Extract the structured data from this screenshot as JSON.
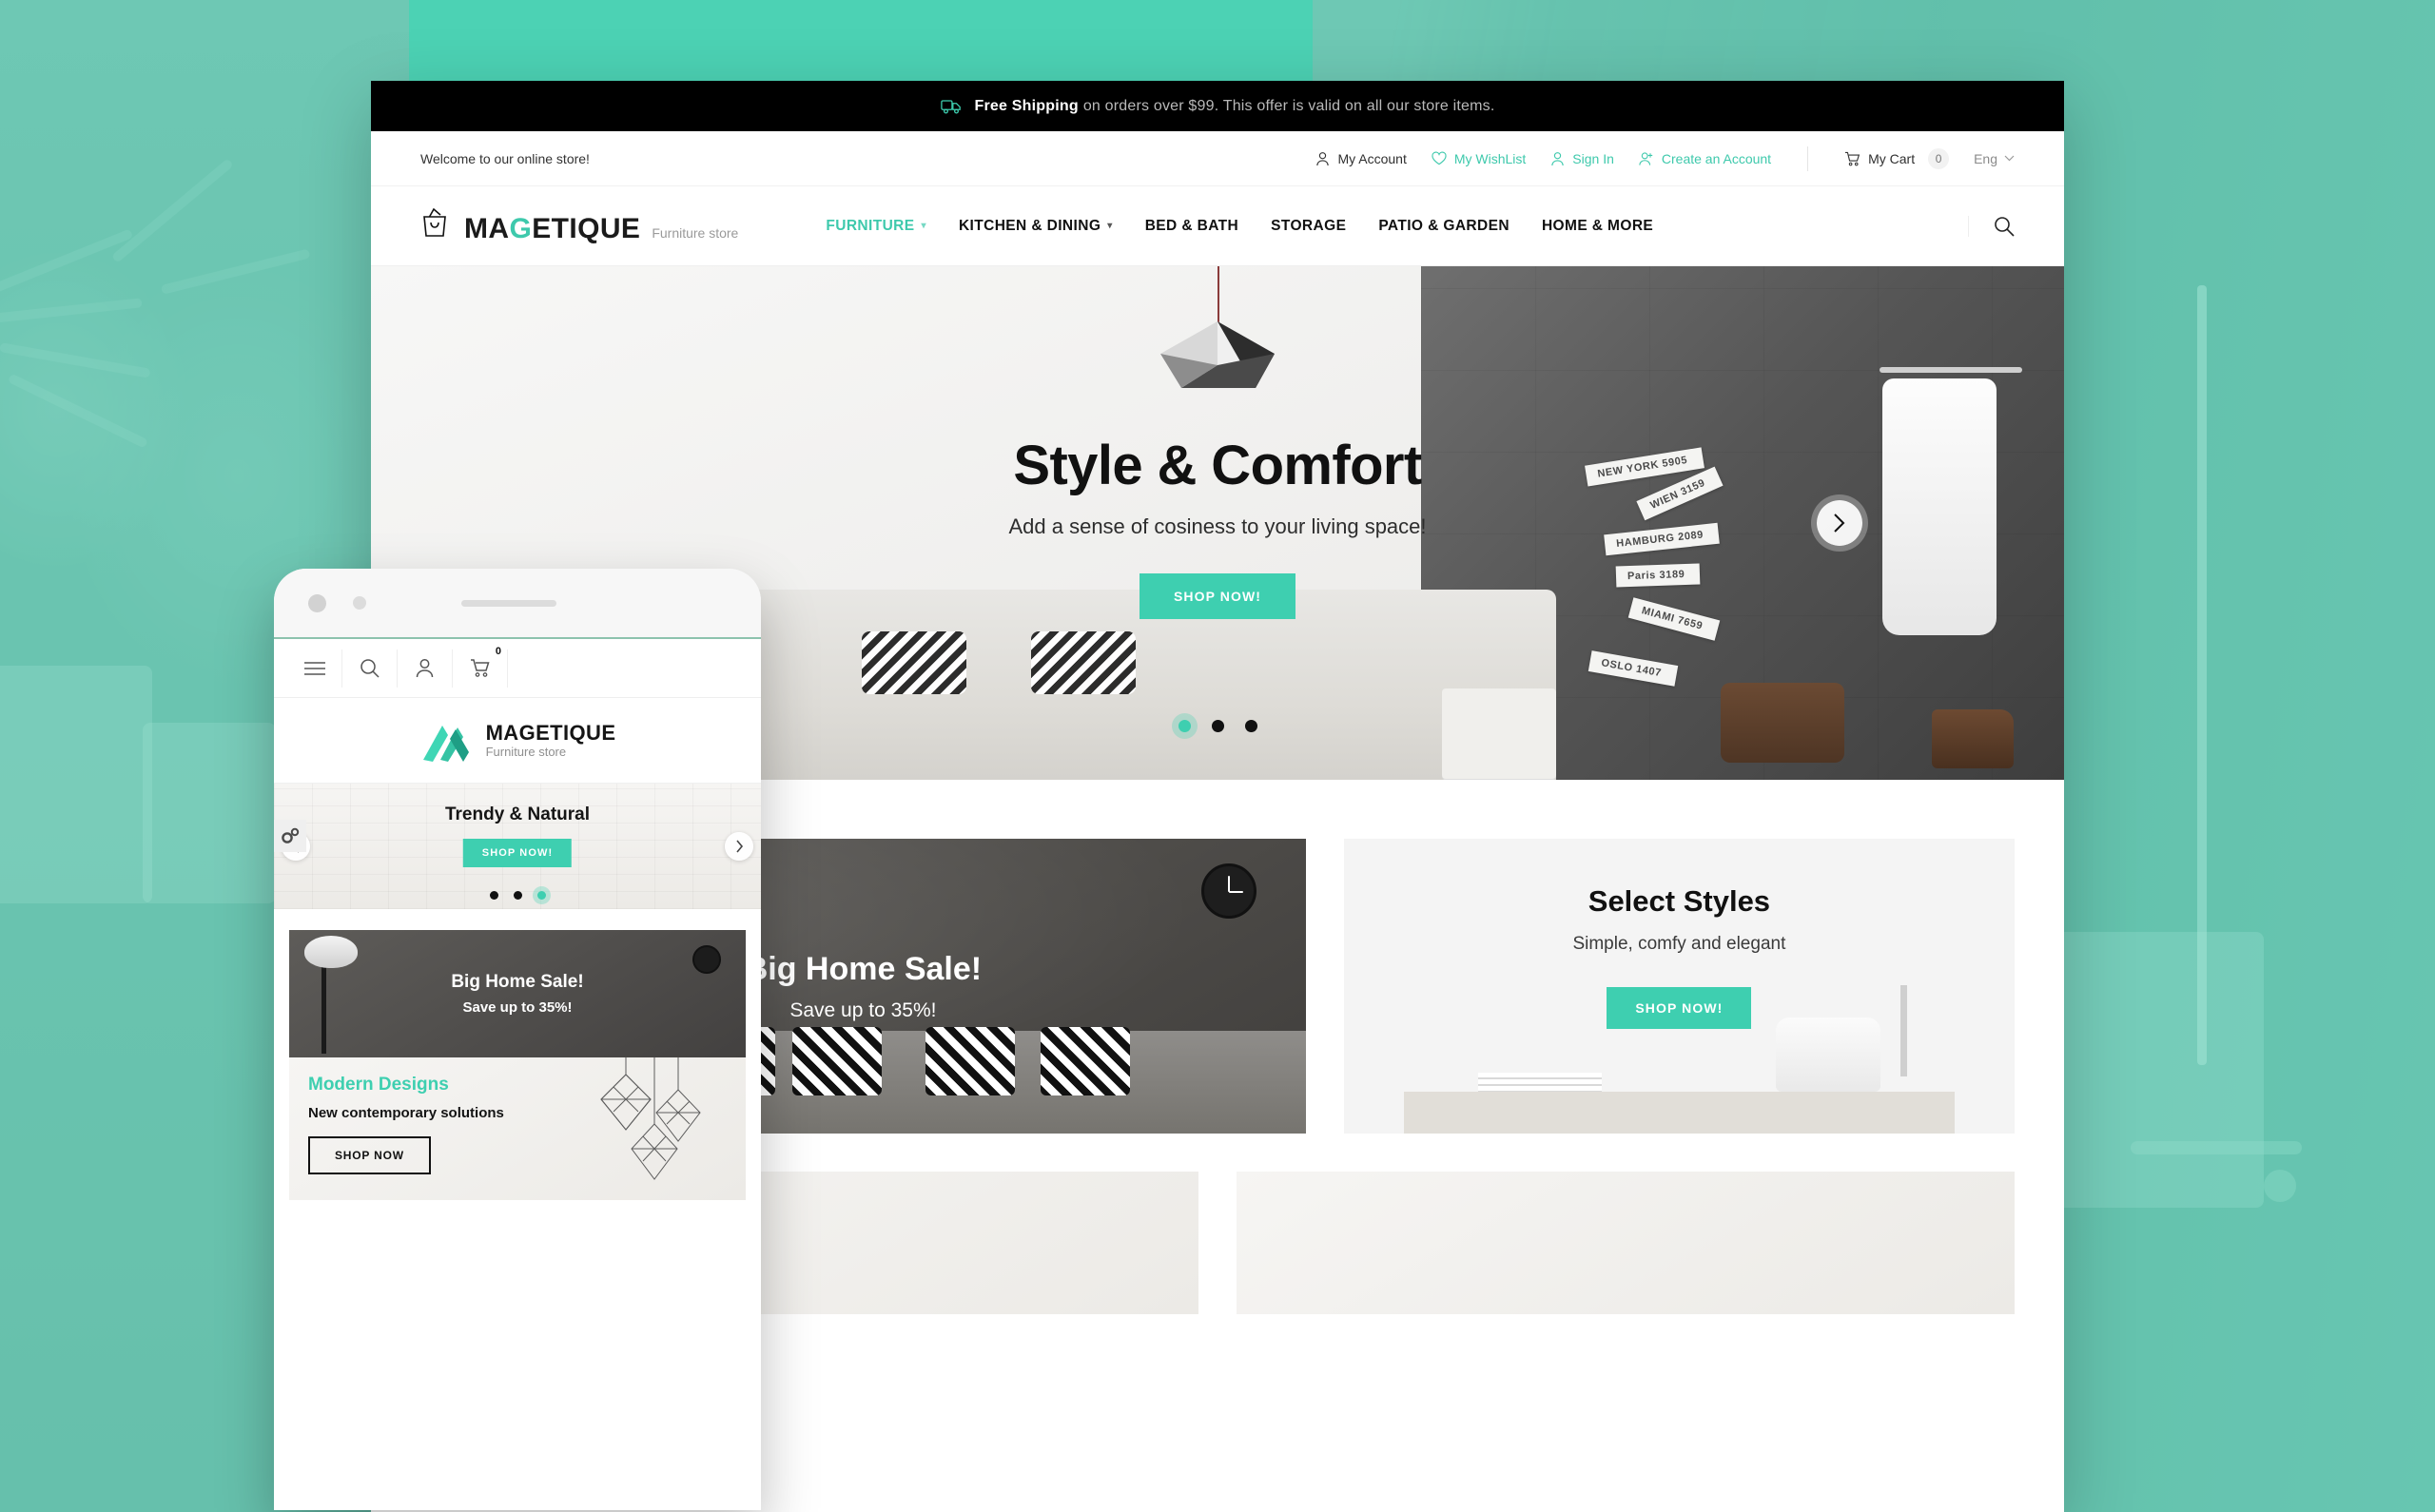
{
  "background": {
    "color": "#4cd2b4"
  },
  "desktop": {
    "shipping_bar": {
      "icon": "truck-icon",
      "strong": "Free Shipping",
      "rest": "on orders over $99. This offer is valid on all our store items."
    },
    "utility_bar": {
      "welcome": "Welcome to our online store!",
      "links": [
        {
          "label": "My Account",
          "icon": "user-icon",
          "accent": false
        },
        {
          "label": "My WishList",
          "icon": "heart-icon",
          "accent": true
        },
        {
          "label": "Sign In",
          "icon": "user-sign-in-icon",
          "accent": true
        },
        {
          "label": "Create an Account",
          "icon": "user-add-icon",
          "accent": true
        }
      ],
      "cart": {
        "label": "My Cart",
        "icon": "cart-icon",
        "count": "0"
      },
      "language": {
        "label": "Eng",
        "icon": "chevron-down-icon"
      }
    },
    "header": {
      "logo": {
        "icon": "shopping-bag-icon",
        "pre": "MA",
        "accent": "G",
        "post": "ETIQUE",
        "subtitle": "Furniture store"
      },
      "nav": [
        {
          "label": "FURNITURE",
          "active": true,
          "caret": true
        },
        {
          "label": "KITCHEN & DINING",
          "active": false,
          "caret": true
        },
        {
          "label": "BED & BATH",
          "active": false,
          "caret": false
        },
        {
          "label": "STORAGE",
          "active": false,
          "caret": false
        },
        {
          "label": "PATIO & GARDEN",
          "active": false,
          "caret": false
        },
        {
          "label": "HOME & MORE",
          "active": false,
          "caret": false
        }
      ],
      "search_icon": "search-icon"
    },
    "hero": {
      "title": "Style & Comfort",
      "subtitle": "Add a sense of cosiness to your living space!",
      "cta": "SHOP NOW!",
      "next_icon": "chevron-right-icon",
      "dots": 3,
      "active_dot": 0,
      "signs": [
        "NEW YORK 5905",
        "WIEN 3159",
        "HAMBURG 2089",
        "Paris 3189",
        "MIAMI 7659",
        "OSLO 1407"
      ]
    },
    "promos": [
      {
        "title": "Big Home Sale!",
        "subtitle": "Save up to 35%!"
      },
      {
        "title": "Select Styles",
        "subtitle": "Simple, comfy and elegant",
        "cta": "SHOP NOW!"
      }
    ]
  },
  "phone": {
    "toolbar": [
      {
        "icon": "hamburger-menu-icon"
      },
      {
        "icon": "search-icon"
      },
      {
        "icon": "user-icon"
      },
      {
        "icon": "cart-icon",
        "badge": "0"
      }
    ],
    "logo": {
      "icon": "m-mark-icon",
      "title": "MAGETIQUE",
      "subtitle": "Furniture store"
    },
    "settings_icon": "gears-icon",
    "slider": {
      "title": "Trendy & Natural",
      "cta": "SHOP NOW!",
      "prev_icon": "chevron-left-icon",
      "next_icon": "chevron-right-icon",
      "dots": 3,
      "active_dot": 2
    },
    "promo1": {
      "title": "Big Home Sale!",
      "subtitle": "Save up to 35%!"
    },
    "promo2": {
      "title": "Modern Designs",
      "subtitle": "New contemporary solutions",
      "cta": "SHOP NOW"
    }
  },
  "colors": {
    "accent": "#3ecfb0",
    "bg": "#4cd2b4",
    "dark": "#000000"
  }
}
